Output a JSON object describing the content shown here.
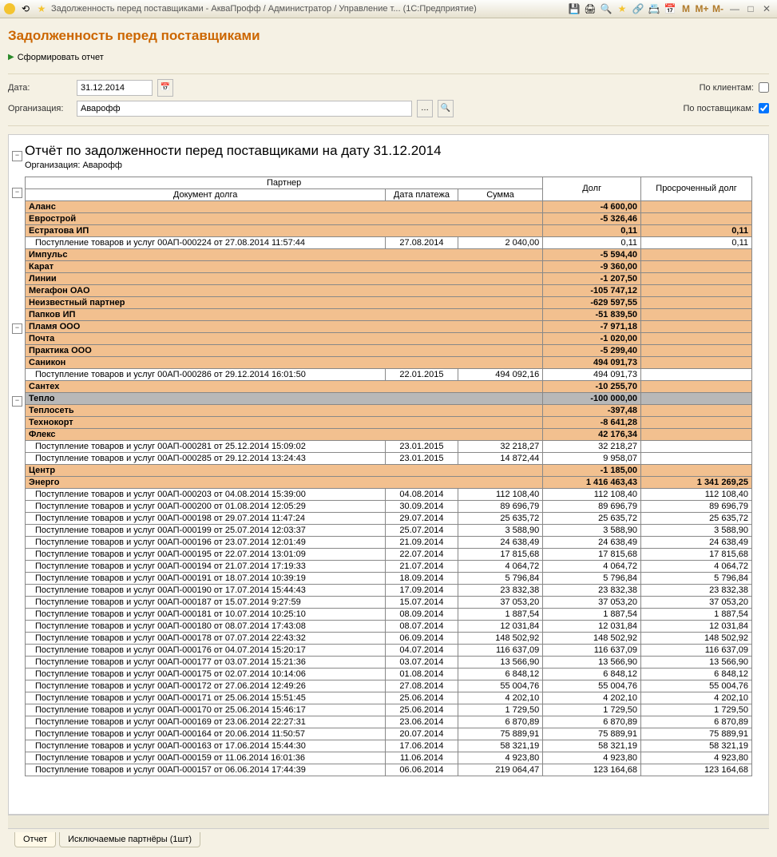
{
  "window": {
    "title": "Задолженность перед поставщиками - АкваПрофф / Администратор / Управление т... (1С:Предприятие)"
  },
  "page_title": "Задолженность перед поставщиками",
  "actions": {
    "generate": "Сформировать отчет"
  },
  "filters": {
    "date_label": "Дата:",
    "date_value": "31.12.2014",
    "org_label": "Организация:",
    "org_value": "Аварофф",
    "by_clients": "По клиентам:",
    "by_clients_checked": false,
    "by_suppliers": "По поставщикам:",
    "by_suppliers_checked": true
  },
  "report": {
    "title": "Отчёт по задолженности перед поставщиками на дату 31.12.2014",
    "org_line": "Организация: Аварофф",
    "headers": {
      "partner": "Партнер",
      "doc": "Документ долга",
      "pay_date": "Дата платежа",
      "sum": "Сумма",
      "debt": "Долг",
      "overdue": "Просроченный долг"
    },
    "rows": [
      {
        "t": "p",
        "name": "Аланс",
        "debt": "-4 600,00"
      },
      {
        "t": "p",
        "name": "Еврострой",
        "debt": "-5 326,46"
      },
      {
        "t": "p",
        "name": "Естратова ИП",
        "debt": "0,11",
        "over": "0,11"
      },
      {
        "t": "d",
        "name": "Поступление товаров и услуг 00АП-000224 от 27.08.2014 11:57:44",
        "date": "27.08.2014",
        "sum": "2 040,00",
        "debt": "0,11",
        "over": "0,11"
      },
      {
        "t": "p",
        "name": "Импульс",
        "debt": "-5 594,40"
      },
      {
        "t": "p",
        "name": "Карат",
        "debt": "-9 360,00"
      },
      {
        "t": "p",
        "name": "Линии",
        "debt": "-1 207,50"
      },
      {
        "t": "p",
        "name": "Мегафон ОАО",
        "debt": "-105 747,12"
      },
      {
        "t": "p",
        "name": "Неизвестный партнер",
        "debt": "-629 597,55"
      },
      {
        "t": "p",
        "name": "Папков ИП",
        "debt": "-51 839,50"
      },
      {
        "t": "p",
        "name": "Пламя ООО",
        "debt": "-7 971,18"
      },
      {
        "t": "p",
        "name": "Почта",
        "debt": "-1 020,00"
      },
      {
        "t": "p",
        "name": "Практика ООО",
        "debt": "-5 299,40"
      },
      {
        "t": "p",
        "name": "Саникон",
        "debt": "494 091,73"
      },
      {
        "t": "d",
        "name": "Поступление товаров и услуг 00АП-000286 от 29.12.2014 16:01:50",
        "date": "22.01.2015",
        "sum": "494 092,16",
        "debt": "494 091,73"
      },
      {
        "t": "p",
        "name": "Сантех",
        "debt": "-10 255,70"
      },
      {
        "t": "s",
        "name": "Тепло",
        "debt": "-100 000,00"
      },
      {
        "t": "p",
        "name": "Теплосеть",
        "debt": "-397,48"
      },
      {
        "t": "p",
        "name": "Технокорт",
        "debt": "-8 641,28"
      },
      {
        "t": "p",
        "name": "Флекс",
        "debt": "42 176,34"
      },
      {
        "t": "d",
        "name": "Поступление товаров и услуг 00АП-000281 от 25.12.2014 15:09:02",
        "date": "23.01.2015",
        "sum": "32 218,27",
        "debt": "32 218,27"
      },
      {
        "t": "d",
        "name": "Поступление товаров и услуг 00АП-000285 от 29.12.2014 13:24:43",
        "date": "23.01.2015",
        "sum": "14 872,44",
        "debt": "9 958,07"
      },
      {
        "t": "p",
        "name": "Центр",
        "debt": "-1 185,00"
      },
      {
        "t": "p",
        "name": "Энерго",
        "debt": "1 416 463,43",
        "over": "1 341 269,25"
      },
      {
        "t": "d",
        "name": "Поступление товаров и услуг 00АП-000203 от 04.08.2014 15:39:00",
        "date": "04.08.2014",
        "sum": "112 108,40",
        "debt": "112 108,40",
        "over": "112 108,40"
      },
      {
        "t": "d",
        "name": "Поступление товаров и услуг 00АП-000200 от 01.08.2014 12:05:29",
        "date": "30.09.2014",
        "sum": "89 696,79",
        "debt": "89 696,79",
        "over": "89 696,79"
      },
      {
        "t": "d",
        "name": "Поступление товаров и услуг 00АП-000198 от 29.07.2014 11:47:24",
        "date": "29.07.2014",
        "sum": "25 635,72",
        "debt": "25 635,72",
        "over": "25 635,72"
      },
      {
        "t": "d",
        "name": "Поступление товаров и услуг 00АП-000199 от 25.07.2014 12:03:37",
        "date": "25.07.2014",
        "sum": "3 588,90",
        "debt": "3 588,90",
        "over": "3 588,90"
      },
      {
        "t": "d",
        "name": "Поступление товаров и услуг 00АП-000196 от 23.07.2014 12:01:49",
        "date": "21.09.2014",
        "sum": "24 638,49",
        "debt": "24 638,49",
        "over": "24 638,49"
      },
      {
        "t": "d",
        "name": "Поступление товаров и услуг 00АП-000195 от 22.07.2014 13:01:09",
        "date": "22.07.2014",
        "sum": "17 815,68",
        "debt": "17 815,68",
        "over": "17 815,68"
      },
      {
        "t": "d",
        "name": "Поступление товаров и услуг 00АП-000194 от 21.07.2014 17:19:33",
        "date": "21.07.2014",
        "sum": "4 064,72",
        "debt": "4 064,72",
        "over": "4 064,72"
      },
      {
        "t": "d",
        "name": "Поступление товаров и услуг 00АП-000191 от 18.07.2014 10:39:19",
        "date": "18.09.2014",
        "sum": "5 796,84",
        "debt": "5 796,84",
        "over": "5 796,84"
      },
      {
        "t": "d",
        "name": "Поступление товаров и услуг 00АП-000190 от 17.07.2014 15:44:43",
        "date": "17.09.2014",
        "sum": "23 832,38",
        "debt": "23 832,38",
        "over": "23 832,38"
      },
      {
        "t": "d",
        "name": "Поступление товаров и услуг 00АП-000187 от 15.07.2014 9:27:59",
        "date": "15.07.2014",
        "sum": "37 053,20",
        "debt": "37 053,20",
        "over": "37 053,20"
      },
      {
        "t": "d",
        "name": "Поступление товаров и услуг 00АП-000181 от 10.07.2014 10:25:10",
        "date": "08.09.2014",
        "sum": "1 887,54",
        "debt": "1 887,54",
        "over": "1 887,54"
      },
      {
        "t": "d",
        "name": "Поступление товаров и услуг 00АП-000180 от 08.07.2014 17:43:08",
        "date": "08.07.2014",
        "sum": "12 031,84",
        "debt": "12 031,84",
        "over": "12 031,84"
      },
      {
        "t": "d",
        "name": "Поступление товаров и услуг 00АП-000178 от 07.07.2014 22:43:32",
        "date": "06.09.2014",
        "sum": "148 502,92",
        "debt": "148 502,92",
        "over": "148 502,92"
      },
      {
        "t": "d",
        "name": "Поступление товаров и услуг 00АП-000176 от 04.07.2014 15:20:17",
        "date": "04.07.2014",
        "sum": "116 637,09",
        "debt": "116 637,09",
        "over": "116 637,09"
      },
      {
        "t": "d",
        "name": "Поступление товаров и услуг 00АП-000177 от 03.07.2014 15:21:36",
        "date": "03.07.2014",
        "sum": "13 566,90",
        "debt": "13 566,90",
        "over": "13 566,90"
      },
      {
        "t": "d",
        "name": "Поступление товаров и услуг 00АП-000175 от 02.07.2014 10:14:06",
        "date": "01.08.2014",
        "sum": "6 848,12",
        "debt": "6 848,12",
        "over": "6 848,12"
      },
      {
        "t": "d",
        "name": "Поступление товаров и услуг 00АП-000172 от 27.06.2014 12:49:26",
        "date": "27.08.2014",
        "sum": "55 004,76",
        "debt": "55 004,76",
        "over": "55 004,76"
      },
      {
        "t": "d",
        "name": "Поступление товаров и услуг 00АП-000171 от 25.06.2014 15:51:45",
        "date": "25.06.2014",
        "sum": "4 202,10",
        "debt": "4 202,10",
        "over": "4 202,10"
      },
      {
        "t": "d",
        "name": "Поступление товаров и услуг 00АП-000170 от 25.06.2014 15:46:17",
        "date": "25.06.2014",
        "sum": "1 729,50",
        "debt": "1 729,50",
        "over": "1 729,50"
      },
      {
        "t": "d",
        "name": "Поступление товаров и услуг 00АП-000169 от 23.06.2014 22:27:31",
        "date": "23.06.2014",
        "sum": "6 870,89",
        "debt": "6 870,89",
        "over": "6 870,89"
      },
      {
        "t": "d",
        "name": "Поступление товаров и услуг 00АП-000164 от 20.06.2014 11:50:57",
        "date": "20.07.2014",
        "sum": "75 889,91",
        "debt": "75 889,91",
        "over": "75 889,91"
      },
      {
        "t": "d",
        "name": "Поступление товаров и услуг 00АП-000163 от 17.06.2014 15:44:30",
        "date": "17.06.2014",
        "sum": "58 321,19",
        "debt": "58 321,19",
        "over": "58 321,19"
      },
      {
        "t": "d",
        "name": "Поступление товаров и услуг 00АП-000159 от 11.06.2014 16:01:36",
        "date": "11.06.2014",
        "sum": "4 923,80",
        "debt": "4 923,80",
        "over": "4 923,80"
      },
      {
        "t": "d",
        "name": "Поступление товаров и услуг 00АП-000157 от 06.06.2014 17:44:39",
        "date": "06.06.2014",
        "sum": "219 064,47",
        "debt": "123 164,68",
        "over": "123 164,68"
      }
    ]
  },
  "tabs": {
    "report": "Отчет",
    "excluded": "Исключаемые партнёры (1шт)"
  }
}
